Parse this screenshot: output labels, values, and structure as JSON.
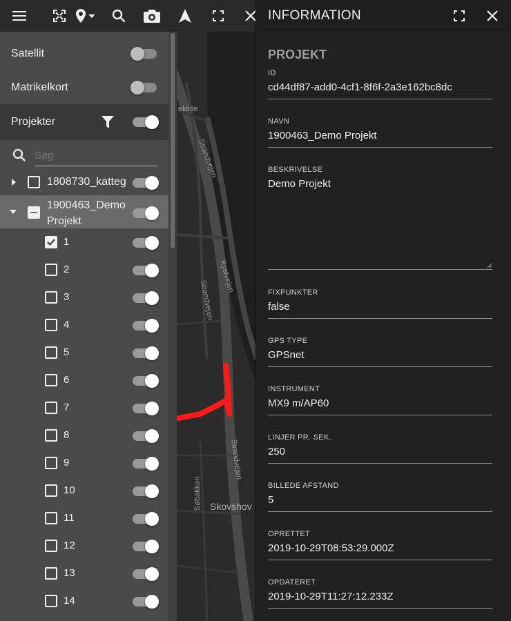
{
  "map": {
    "labels": {
      "kilde": "ekilde",
      "strandvejen_top": "Strandvejen",
      "strandvejen_mid": "Strandvejen",
      "strandvejen_low": "Strandvejen",
      "kystvejen": "Kystvejen",
      "sobakken": "Søbakken",
      "skovshoved": "Skovshov"
    },
    "route_color": "#ff1a1a"
  },
  "toolbar": {
    "icons": [
      "menu-icon",
      "zoom-extent-icon",
      "location-pin-icon",
      "search-icon",
      "camera-icon",
      "navigation-arrow-icon",
      "fullscreen-icon",
      "close-icon"
    ]
  },
  "layers": {
    "satellite": {
      "label": "Satellit",
      "on": false
    },
    "cadastre": {
      "label": "Matrikelkort",
      "on": false
    },
    "projects": {
      "label": "Projekter",
      "on": true
    },
    "search_placeholder": "Søg",
    "project_items": [
      {
        "label": "1808730_katteg",
        "expanded": false,
        "checked": false,
        "on": true
      },
      {
        "label_line1": "1900463_Demo",
        "label_line2": "Projekt",
        "expanded": true,
        "indeterminate": true,
        "on": true
      }
    ],
    "sublayers": [
      {
        "label": "1",
        "checked": true,
        "on": true
      },
      {
        "label": "2",
        "checked": false,
        "on": true
      },
      {
        "label": "3",
        "checked": false,
        "on": true
      },
      {
        "label": "4",
        "checked": false,
        "on": true
      },
      {
        "label": "5",
        "checked": false,
        "on": true
      },
      {
        "label": "6",
        "checked": false,
        "on": true
      },
      {
        "label": "7",
        "checked": false,
        "on": true
      },
      {
        "label": "8",
        "checked": false,
        "on": true
      },
      {
        "label": "9",
        "checked": false,
        "on": true
      },
      {
        "label": "10",
        "checked": false,
        "on": true
      },
      {
        "label": "11",
        "checked": false,
        "on": true
      },
      {
        "label": "12",
        "checked": false,
        "on": true
      },
      {
        "label": "13",
        "checked": false,
        "on": true
      },
      {
        "label": "14",
        "checked": false,
        "on": true
      }
    ]
  },
  "info": {
    "title": "INFORMATION",
    "section": "PROJEKT",
    "fields": [
      {
        "label": "ID",
        "value": "cd44df87-add0-4cf1-8f6f-2a3e162bc8dc"
      },
      {
        "label": "NAVN",
        "value": "1900463_Demo Projekt"
      },
      {
        "label": "BESKRIVELSE",
        "value": "Demo Projekt"
      },
      {
        "label": "FIXPUNKTER",
        "value": "false"
      },
      {
        "label": "GPS TYPE",
        "value": "GPSnet"
      },
      {
        "label": "INSTRUMENT",
        "value": "MX9 m/AP60"
      },
      {
        "label": "LINJER PR. SEK.",
        "value": "250"
      },
      {
        "label": "BILLEDE AFSTAND",
        "value": "5"
      },
      {
        "label": "OPRETTET",
        "value": "2019-10-29T08:53:29.000Z"
      },
      {
        "label": "OPDATERET",
        "value": "2019-10-29T11:27:12.233Z"
      }
    ]
  }
}
